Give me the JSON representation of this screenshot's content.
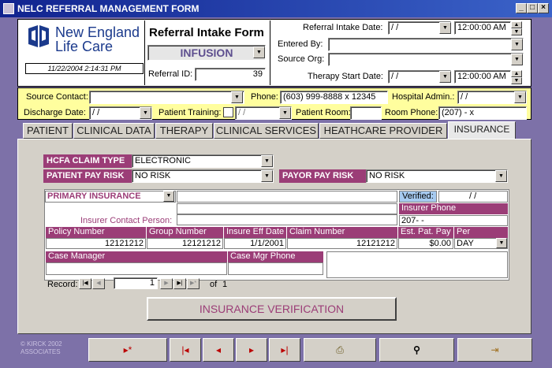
{
  "window": {
    "title": "NELC REFERRAL MANAGEMENT FORM",
    "min": "_",
    "max": "□",
    "close": "×"
  },
  "logo": {
    "line1": "New England",
    "line2": "Life Care",
    "timestamp": "11/22/2004 2:14:31 PM"
  },
  "header": {
    "form_title": "Referral Intake Form",
    "referral_type": "INFUSION",
    "referral_id_label": "Referral ID:",
    "referral_id": "39",
    "intake_date_label": "Referral Intake Date:",
    "intake_date": "/    /",
    "intake_time": "12:00:00 AM",
    "entered_by_label": "Entered By:",
    "entered_by": "",
    "source_org_label": "Source Org:",
    "source_org": "",
    "therapy_start_label": "Therapy Start Date:",
    "therapy_start_date": "/    /",
    "therapy_start_time": "12:00:00 AM"
  },
  "contact": {
    "source_contact_label": "Source Contact:",
    "source_contact": "",
    "phone_label": "Phone:",
    "phone": "(603) 999-8888 x 12345",
    "hospital_admin_label": "Hospital Admin.:",
    "hospital_admin": "/    /",
    "discharge_label": "Discharge Date:",
    "discharge": "/    /",
    "patient_training_label": "Patient Training:",
    "patient_training": "/    /",
    "patient_room_label": "Patient Room:",
    "patient_room": "",
    "room_phone_label": "Room Phone:",
    "room_phone": "(207)    -       x"
  },
  "tabs": [
    "PATIENT",
    "CLINICAL DATA",
    "THERAPY",
    "CLINICAL SERVICES",
    "HEATHCARE PROVIDER",
    "INSURANCE"
  ],
  "insurance": {
    "hcfa_label": "HCFA CLAIM TYPE",
    "hcfa_value": "ELECTRONIC",
    "patient_pay_label": "PATIENT PAY RISK",
    "patient_pay_value": "NO RISK",
    "payor_pay_label": "PAYOR PAY RISK",
    "payor_pay_value": "NO RISK",
    "primary_label": "PRIMARY INSURANCE",
    "verified_label": "Verified:",
    "verified_value": "/    /",
    "insurer_phone_label": "Insurer Phone",
    "insurer_phone": "207-    -",
    "insurer_contact_label": "Insurer Contact Person:",
    "policy_label": "Policy Number",
    "policy_value": "12121212",
    "group_label": "Group Number",
    "group_value": "12121212",
    "eff_label": "Insure Eff Date",
    "eff_value": "1/1/2001",
    "claim_label": "Claim Number",
    "claim_value": "12121212",
    "est_label": "Est. Pat. Pay",
    "est_value": "$0.00",
    "per_label": "Per",
    "per_value": "DAY",
    "case_mgr_label": "Case Manager",
    "case_mgr_phone_label": "Case Mgr Phone",
    "record_label": "Record:",
    "record_value": "1",
    "record_of": "of",
    "record_total": "1",
    "verify_button": "INSURANCE VERIFICATION"
  },
  "footer": {
    "copyright1": "© KIRCK 2002",
    "copyright2": "ASSOCIATES"
  },
  "colors": {
    "purple": "#9b3d77",
    "yellow": "#fffe9e",
    "background": "#7d71a8",
    "title": "#11238f"
  }
}
